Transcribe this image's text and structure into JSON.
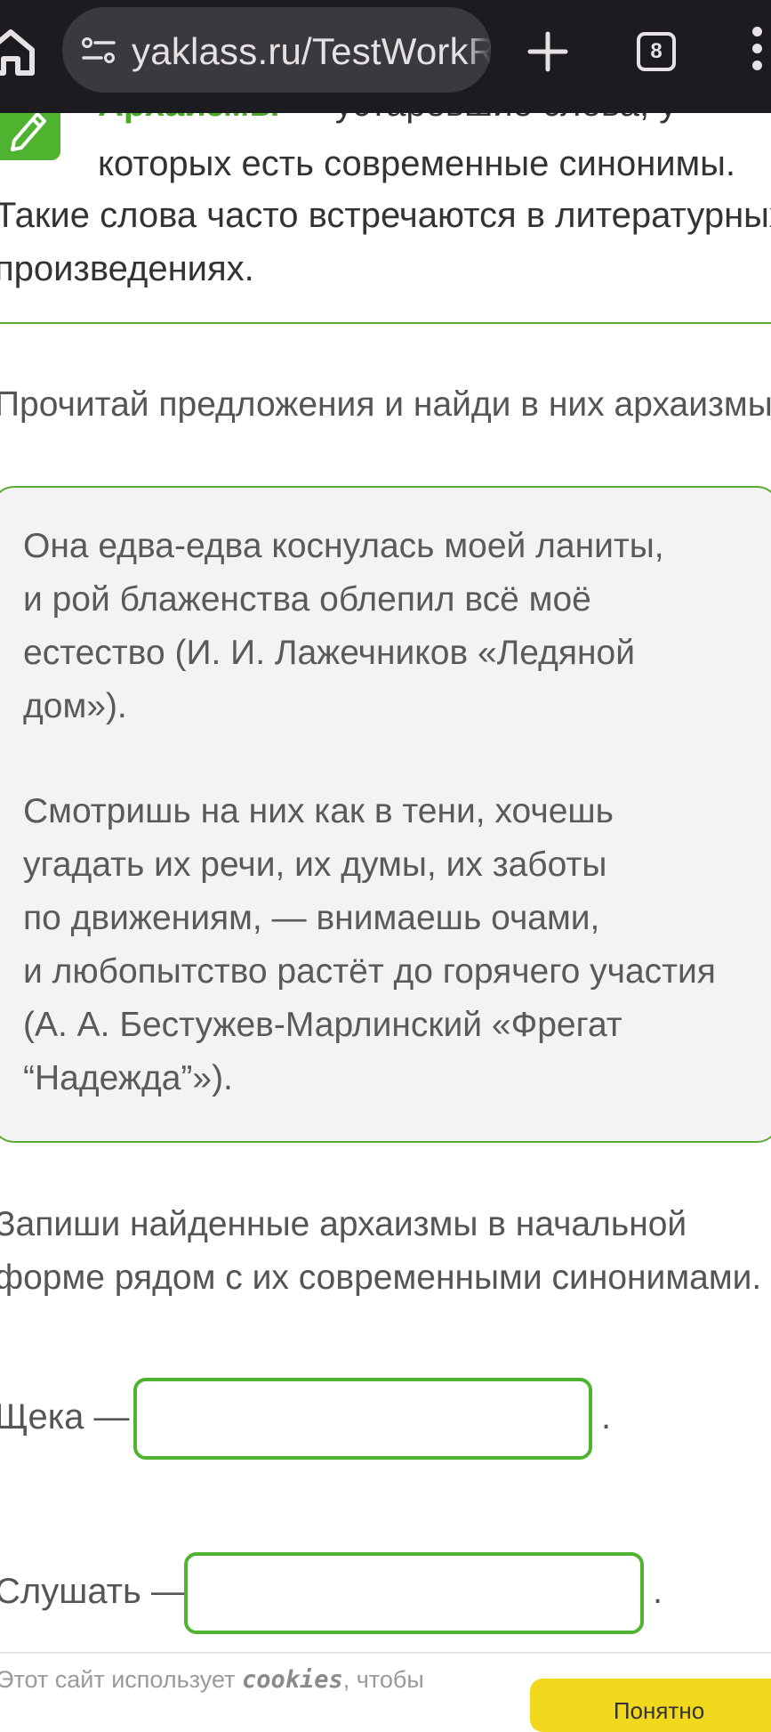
{
  "browser": {
    "url": "yaklass.ru/TestWorkRu",
    "tab_count": "8"
  },
  "hint": {
    "term": "Архаизмы",
    "line1_rest": " — устаревшие слова, у",
    "line2": "которых есть современные синонимы.",
    "line3": "Такие слова часто встречаются в литературных",
    "line4": "произведениях."
  },
  "instruction": "Прочитай предложения и найди в них архаизмы.",
  "quotes": {
    "q1": [
      "Она едва-едва коснулась моей ланиты,",
      "и рой блаженства облепил всё моё",
      "естество (И. И. Лажечников «Ледяной",
      "дом»)."
    ],
    "q2": [
      "Смотришь на них как в тени, хочешь",
      "угадать их речи, их думы, их заботы",
      "по движениям, — внимаешь очами,",
      "и любопытство растёт до горячего участия",
      "(А. А. Бестужев-Марлинский «Фрегат",
      "“Надежда”»)."
    ]
  },
  "task": {
    "line1": "Запиши найденные архаизмы в начальной",
    "line2": "форме рядом с их современными синонимами."
  },
  "answers": [
    {
      "label": "Щека —",
      "value": "",
      "end": "."
    },
    {
      "label": "Слушать —",
      "value": "",
      "end": "."
    }
  ],
  "cookie": {
    "text_before": "Этот сайт использует ",
    "text_code": "cookies",
    "text_after": ", чтобы",
    "button": "Понятно"
  },
  "colors": {
    "accent_green": "#4fb32f",
    "browser_bar": "#1c1b1f",
    "cookie_button": "#f2d81c"
  }
}
